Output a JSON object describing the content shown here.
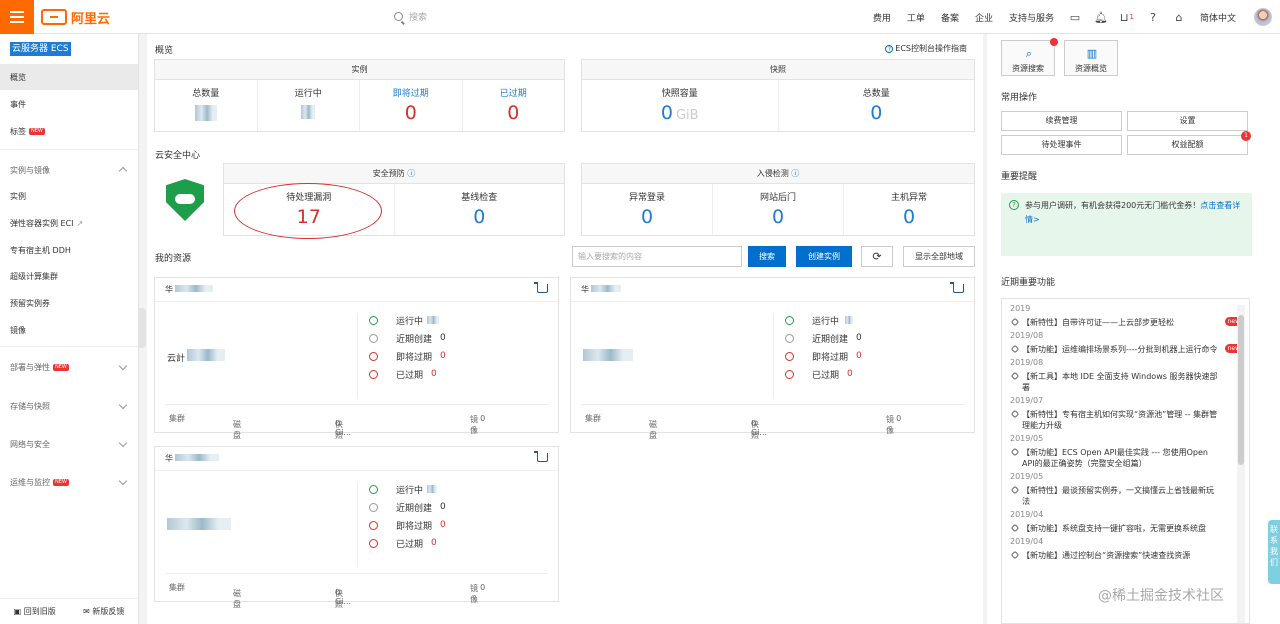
{
  "topbar": {
    "logo": "阿里云",
    "search_placeholder": "搜索",
    "nav": [
      "费用",
      "工单",
      "备案",
      "企业",
      "支持与服务"
    ],
    "cart_count": "1",
    "language": "简体中文"
  },
  "sidebar": {
    "title": "云服务器 ECS",
    "items": [
      {
        "label": "概览"
      },
      {
        "label": "事件"
      },
      {
        "label": "标签"
      },
      {
        "label": "实例与镜像"
      },
      {
        "label": "实例"
      },
      {
        "label": "弹性容器实例 ECI"
      },
      {
        "label": "专有宿主机 DDH"
      },
      {
        "label": "超级计算集群"
      },
      {
        "label": "预留实例券"
      },
      {
        "label": "镜像"
      },
      {
        "label": "部署与弹性"
      },
      {
        "label": "存储与快照"
      },
      {
        "label": "网络与安全"
      },
      {
        "label": "运维与监控"
      }
    ],
    "new_badge": "NEW",
    "bottom": [
      "回到旧版",
      "新版反馈"
    ]
  },
  "overview": {
    "title": "概览",
    "help_link": "ECS控制台操作指南",
    "instances": {
      "header": "实例",
      "total_label": "总数量",
      "running_label": "运行中",
      "expiring_label": "即将过期",
      "expiring_value": "0",
      "expired_label": "已过期",
      "expired_value": "0"
    },
    "snapshots": {
      "header": "快照",
      "capacity_label": "快照容量",
      "capacity_value": "0",
      "capacity_unit": "GiB",
      "total_label": "总数量",
      "total_value": "0"
    }
  },
  "security": {
    "title": "云安全中心",
    "warning": {
      "header": "安全预防",
      "vuln_label": "待处理漏洞",
      "vuln_value": "17",
      "baseline_label": "基线检查",
      "baseline_value": "0"
    },
    "intrusion": {
      "header": "入侵检测",
      "login_label": "异常登录",
      "login_value": "0",
      "backdoor_label": "网站后门",
      "backdoor_value": "0",
      "host_label": "主机异常",
      "host_value": "0"
    }
  },
  "resources": {
    "title": "我的资源",
    "search_placeholder": "输入要搜索的内容",
    "search_btn": "搜索",
    "create_btn": "创建实例",
    "show_all_btn": "显示全部地域",
    "cards": [
      {
        "region": "华",
        "name": "云計",
        "stats": [
          {
            "label": "运行中"
          },
          {
            "label": "近期创建",
            "value": "0"
          },
          {
            "label": "即将过期",
            "value": "0"
          },
          {
            "label": "已过期",
            "value": "0"
          }
        ],
        "footer": {
          "cluster": "集群",
          "disk": "磁盘",
          "snapshot": "快照",
          "snapshot_value": "0 Gi...",
          "image": "镜像",
          "image_value": "0"
        }
      },
      {
        "region": "华",
        "name": "",
        "stats": [
          {
            "label": "运行中"
          },
          {
            "label": "近期创建",
            "value": "0"
          },
          {
            "label": "即将过期",
            "value": "0"
          },
          {
            "label": "已过期",
            "value": "0"
          }
        ],
        "footer": {
          "cluster": "集群",
          "disk": "磁盘",
          "snapshot": "快照",
          "snapshot_value": "0 Gi...",
          "image": "镜像",
          "image_value": "0"
        }
      },
      {
        "region": "华",
        "name": "",
        "stats": [
          {
            "label": "运行中"
          },
          {
            "label": "近期创建",
            "value": "0"
          },
          {
            "label": "即将过期",
            "value": "0"
          },
          {
            "label": "已过期",
            "value": "0"
          }
        ],
        "footer": {
          "cluster": "集群",
          "disk": "磁盘",
          "snapshot": "快照",
          "snapshot_value": "0 Gi...",
          "image": "镜像",
          "image_value": "0"
        }
      }
    ]
  },
  "right": {
    "quick": [
      "资源搜索",
      "资源概览"
    ],
    "ops_title": "常用操作",
    "ops": [
      "续费管理",
      "设置",
      "待处理事件",
      "权益配额"
    ],
    "ops_badge": "1",
    "reminder_title": "重要提醒",
    "reminder_text": "参与用户调研，有机会获得200元无门槛代金券！",
    "reminder_link": "点击查看详情>",
    "news_title": "近期重要功能",
    "news": [
      {
        "year": "2019",
        "text": "【新特性】自带许可证——上云部步更轻松",
        "new": "new"
      },
      {
        "year": "2019/08",
        "text": "【新功能】运维编排场景系列----分批到机器上运行命令",
        "new": "new"
      },
      {
        "year": "2019/08",
        "text": "【新工具】本地 IDE 全面支持 Windows 服务器快速部署"
      },
      {
        "year": "2019/07",
        "text": "【新特性】专有宿主机如何实现“资源池”管理 -- 集群管理能力升级"
      },
      {
        "year": "2019/05",
        "text": "【新功能】ECS Open API最佳实践 --- 您使用Open API的最正确姿势（完整安全组篇）"
      },
      {
        "year": "2019/05",
        "text": "【新特性】最谈预留实例券，一文搞懂云上省钱最新玩法"
      },
      {
        "year": "2019/04",
        "text": "【新功能】系统盘支持一键扩容啦，无需更换系统盘"
      },
      {
        "year": "2019/04",
        "text": "【新功能】通过控制台“资源搜索”快速查找资源"
      }
    ]
  },
  "side_tab": "联系我们",
  "watermark": "@稀土掘金技术社区"
}
